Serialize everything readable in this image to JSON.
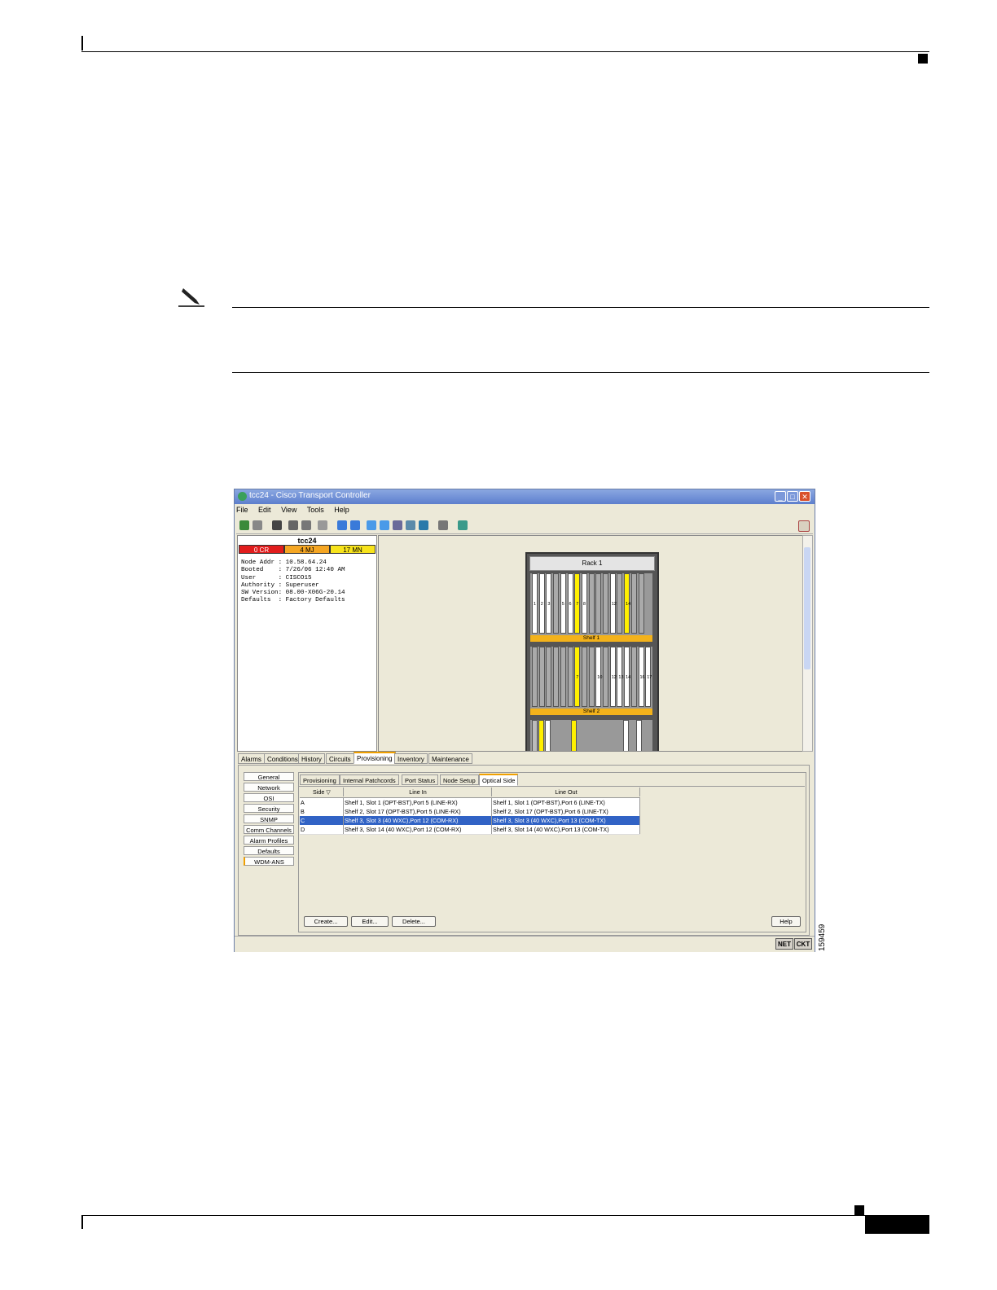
{
  "figure_id": "159459",
  "window": {
    "title": "tcc24 - Cisco Transport Controller",
    "menu": [
      "File",
      "Edit",
      "View",
      "Tools",
      "Help"
    ],
    "controls": {
      "min": "_",
      "max": "□",
      "close": "✕"
    }
  },
  "node": {
    "name": "tcc24",
    "alarms": {
      "cr": "0 CR",
      "mj": "4 MJ",
      "mn": "17 MN"
    },
    "alarm_colors": {
      "cr": "#e11c1c",
      "mj": "#f5a623",
      "mn": "#f7e31b"
    },
    "info": "Node Addr : 10.58.64.24\nBooted    : 7/26/06 12:40 AM\nUser      : CISCO15\nAuthority : Superuser\nSW Version: 08.00-X06G-20.14\nDefaults  : Factory Defaults"
  },
  "rack": {
    "label": "Rack 1",
    "shelves": [
      {
        "label": "Shelf 1",
        "slots": [
          "1",
          "2",
          "3",
          "",
          "5",
          "6",
          "7",
          "8",
          "",
          "",
          "",
          "12",
          "",
          "14",
          "",
          ""
        ]
      },
      {
        "label": "Shelf 2",
        "slots": [
          "",
          "",
          "",
          "",
          "",
          "",
          "7",
          "",
          "",
          "10",
          "",
          "12",
          "13",
          "14",
          "",
          "16",
          "17"
        ]
      }
    ]
  },
  "tabs": [
    "Alarms",
    "Conditions",
    "History",
    "Circuits",
    "Provisioning",
    "Inventory",
    "Maintenance"
  ],
  "selected_tab": "Provisioning",
  "side_menu": [
    "General",
    "Network",
    "OSI",
    "Security",
    "SNMP",
    "Comm Channels",
    "Alarm Profiles",
    "Defaults",
    "WDM-ANS"
  ],
  "subtabs": [
    "Provisioning",
    "Internal Patchcords",
    "Port Status",
    "Node Setup",
    "Optical Side"
  ],
  "selected_subtab": "Optical Side",
  "table": {
    "headers": [
      "Side ▽",
      "Line In",
      "Line Out"
    ],
    "rows": [
      [
        "A",
        "Shelf 1, Slot 1 (OPT-BST),Port 5 (LINE-RX)",
        "Shelf 1, Slot 1 (OPT-BST),Port 6 (LINE-TX)"
      ],
      [
        "B",
        "Shelf 2, Slot 17 (OPT-BST),Port 5 (LINE-RX)",
        "Shelf 2, Slot 17 (OPT-BST),Port 6 (LINE-TX)"
      ],
      [
        "C",
        "Shelf 3, Slot 3 (40 WXC),Port 12 (COM-RX)",
        "Shelf 3, Slot 3 (40 WXC),Port 13 (COM-TX)"
      ],
      [
        "D",
        "Shelf 3, Slot 14 (40 WXC),Port 12 (COM-RX)",
        "Shelf 3, Slot 14 (40 WXC),Port 13 (COM-TX)"
      ]
    ],
    "selected_row": 2
  },
  "buttons": {
    "create": "Create...",
    "edit": "Edit...",
    "delete": "Delete...",
    "help": "Help"
  },
  "status": {
    "net": "NET",
    "ckt": "CKT"
  }
}
